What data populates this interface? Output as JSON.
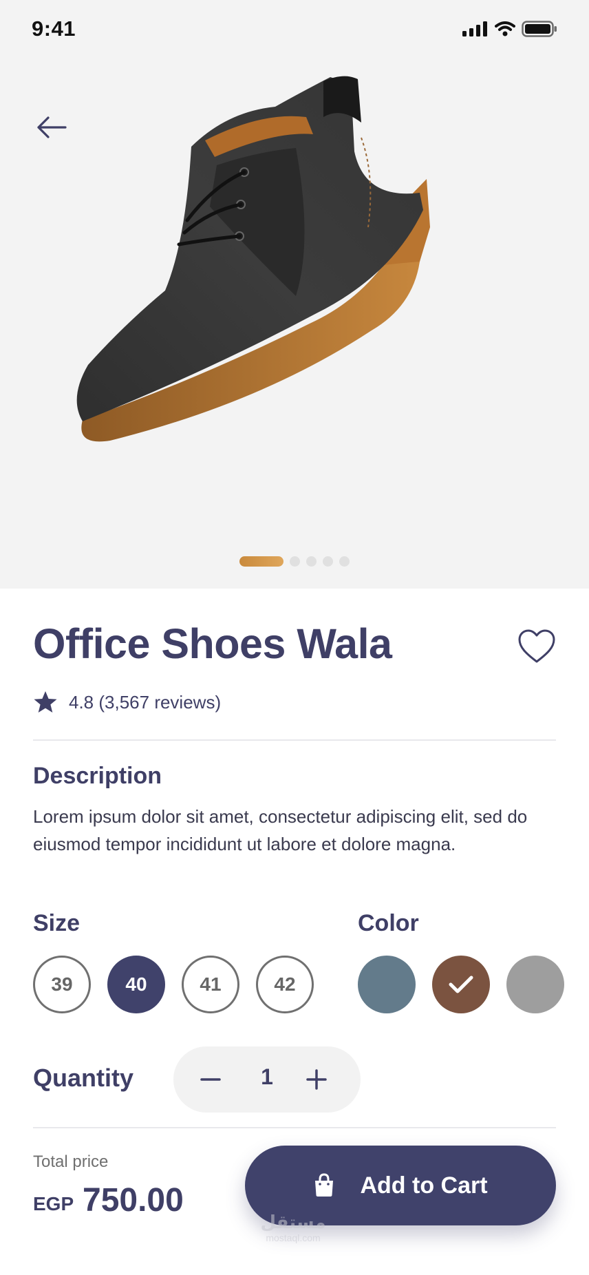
{
  "status_bar": {
    "time": "9:41"
  },
  "carousel": {
    "count": 5,
    "active_index": 0
  },
  "product": {
    "title": "Office Shoes Wala",
    "rating_text": "4.8 (3,567 reviews)",
    "description_heading": "Description",
    "description": "Lorem ipsum dolor sit amet, consectetur adipiscing elit, sed do eiusmod tempor incididunt ut labore et dolore magna."
  },
  "size": {
    "heading": "Size",
    "options": [
      "39",
      "40",
      "41",
      "42"
    ],
    "selected": "40"
  },
  "color": {
    "heading": "Color",
    "swatches": [
      {
        "name": "slate-blue",
        "hex": "#637b8b"
      },
      {
        "name": "brown",
        "hex": "#7b5340",
        "selected": true
      },
      {
        "name": "gray",
        "hex": "#9e9e9e"
      }
    ]
  },
  "quantity": {
    "label": "Quantity",
    "value": "1"
  },
  "footer": {
    "total_label": "Total price",
    "currency": "EGP",
    "price": "750.00",
    "add_to_cart_label": "Add to Cart"
  },
  "watermark": {
    "arabic": "مستقل",
    "latin": "mostaql.com"
  },
  "theme": {
    "primary": "#40426b",
    "accent": "#d49a4a",
    "hero_bg": "#f3f3f3"
  }
}
